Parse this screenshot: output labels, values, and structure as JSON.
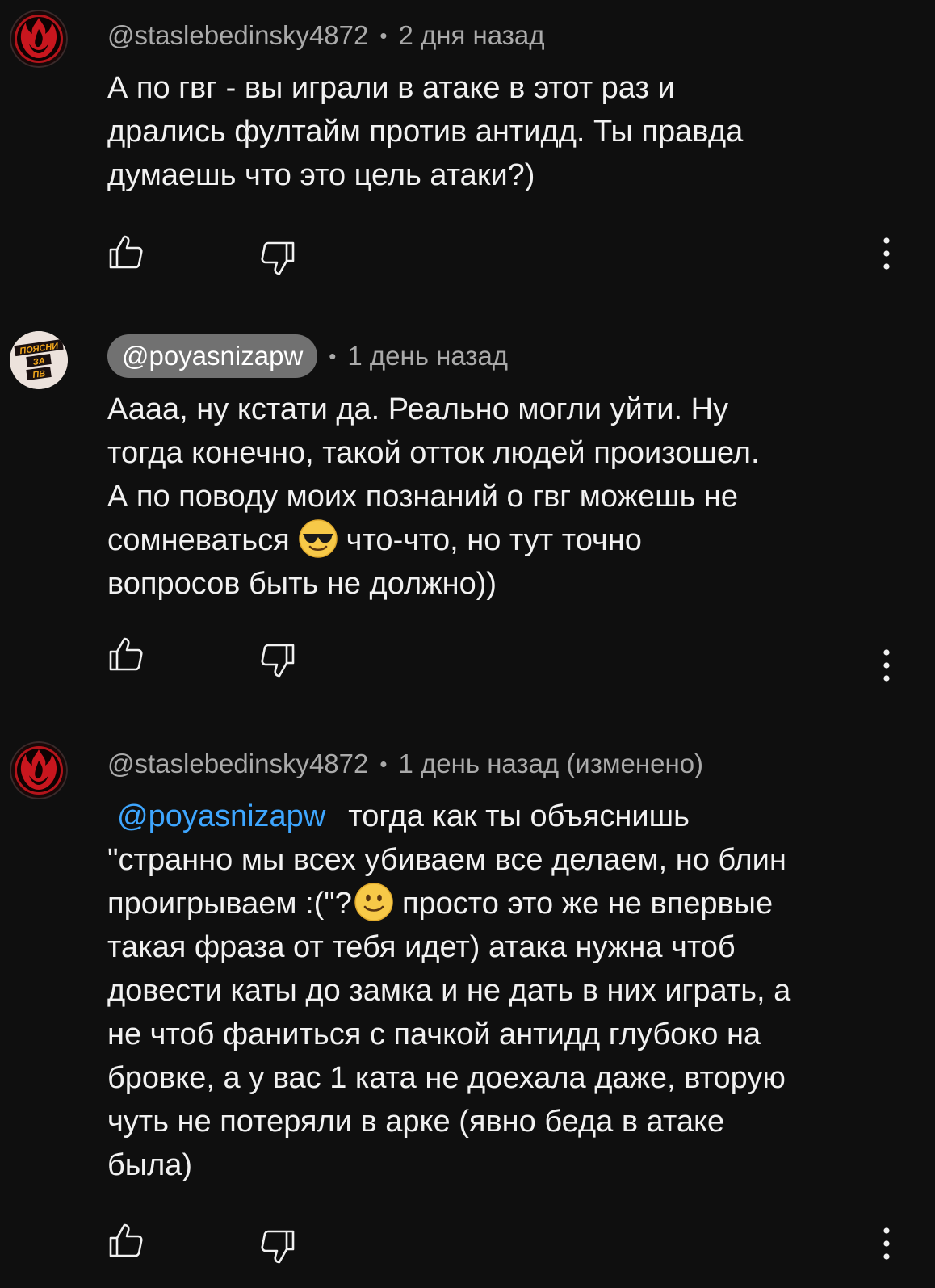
{
  "comments": [
    {
      "author": "@staslebedinsky4872",
      "time": "2 дня назад",
      "lines": [
        "А по гвг - вы играли в атаке в этот раз и",
        "дрались фултайм против антидд. Ты правда",
        "думаешь что это цель атаки?)"
      ]
    },
    {
      "author": "@poyasnizapw",
      "time": "1 день назад",
      "avatar_text": [
        "ПОЯСНИ",
        "ЗА",
        "ПВ"
      ],
      "lines": [
        "Аааа, ну кстати да. Реально могли уйти. Ну",
        "тогда конечно, такой отток людей произошел.",
        "А по поводу моих познаний о гвг можешь не"
      ],
      "line4_a": "сомневаться",
      "line4_b": "что-что, но тут точно",
      "line5": "вопросов быть не должно))",
      "emoji": "smiling-face-with-sunglasses"
    },
    {
      "author": "@staslebedinsky4872",
      "time": "1 день назад (изменено)",
      "mention": "@poyasnizapw",
      "line1_rest": "тогда как ты объяснишь",
      "line2": "\"странно мы всех убиваем все делаем, но блин",
      "line3_a": "проигрываем :(\"?",
      "line3_b": "просто это же не впервые",
      "emoji": "slightly-smiling-face",
      "lines_rest": [
        "такая фраза от тебя идет) атака нужна чтоб",
        "довести каты до замка и не дать в них играть, а",
        "не чтоб фаниться с пачкой антидд глубоко на",
        "бровке, а у вас 1 ката не доехала даже, вторую",
        "чуть не потеряли в арке (явно беда в атаке",
        "была)"
      ]
    }
  ],
  "colors": {
    "background": "#0f0f0f",
    "text": "#f1f1f1",
    "secondary": "#aaaaaa",
    "mention": "#3ea6ff",
    "chip": "#717171"
  },
  "icons": [
    "like-icon",
    "dislike-icon",
    "more-vert-icon"
  ]
}
